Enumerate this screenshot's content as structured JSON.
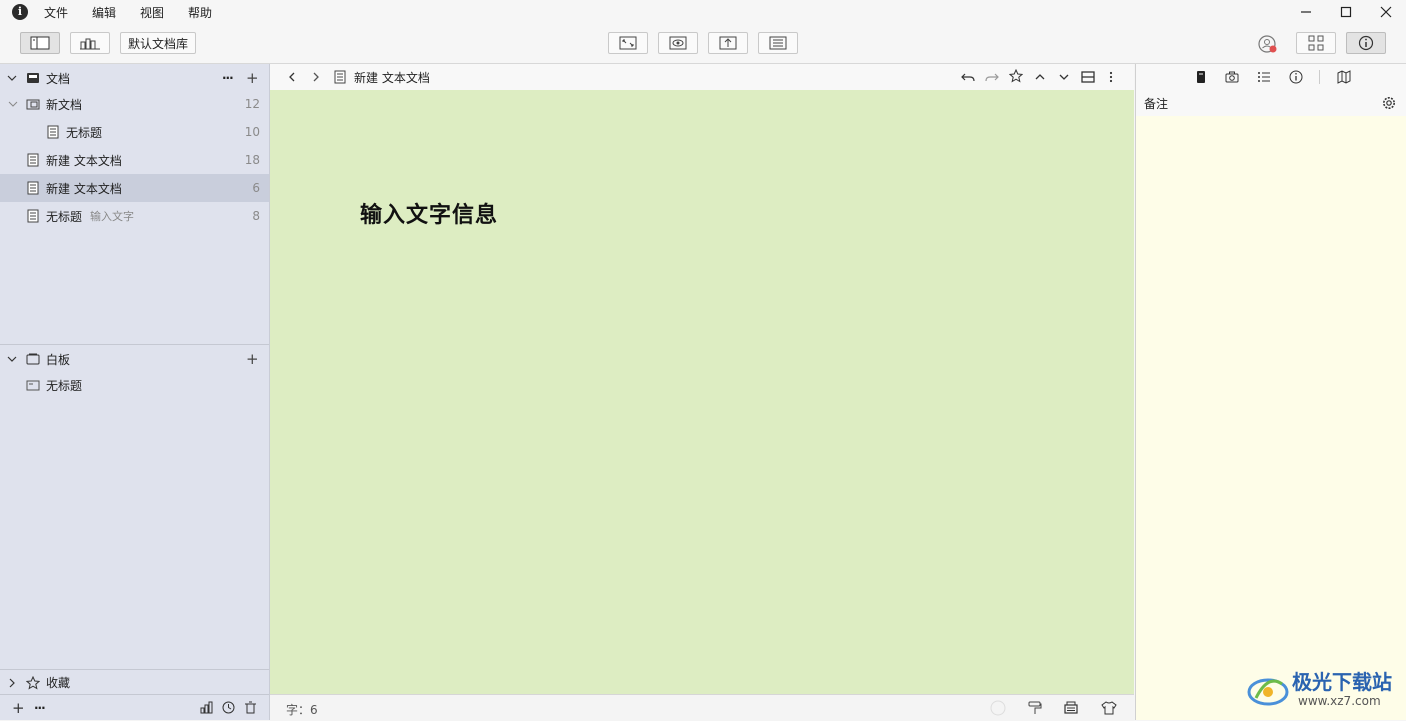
{
  "menubar": {
    "logo": "i",
    "items": [
      "文件",
      "编辑",
      "视图",
      "帮助"
    ]
  },
  "toolbar": {
    "library_label": "默认文档库"
  },
  "sidebar": {
    "docs_section": {
      "title": "文档",
      "more": "···",
      "add": "+",
      "items": [
        {
          "label": "新文档",
          "count": "12",
          "type": "folder"
        },
        {
          "label": "无标题",
          "count": "10",
          "type": "doc"
        },
        {
          "label": "新建 文本文档",
          "count": "18",
          "type": "doc"
        },
        {
          "label": "新建 文本文档",
          "count": "6",
          "type": "doc",
          "selected": true
        },
        {
          "label": "无标题",
          "sub": "输入文字",
          "count": "8",
          "type": "doc"
        }
      ]
    },
    "board_section": {
      "title": "白板",
      "add": "+",
      "items": [
        {
          "label": "无标题"
        }
      ]
    },
    "favorites_section": {
      "title": "收藏"
    },
    "footer": {
      "add": "+",
      "more": "···"
    }
  },
  "editor": {
    "breadcrumb_title": "新建 文本文档",
    "content": "输入文字信息",
    "word_count": "字：6",
    "background": "#ddedc2"
  },
  "inspector": {
    "notes_title": "备注",
    "background": "#fefde8"
  },
  "watermark": {
    "text": "极光下载站",
    "url": "www.xz7.com"
  }
}
